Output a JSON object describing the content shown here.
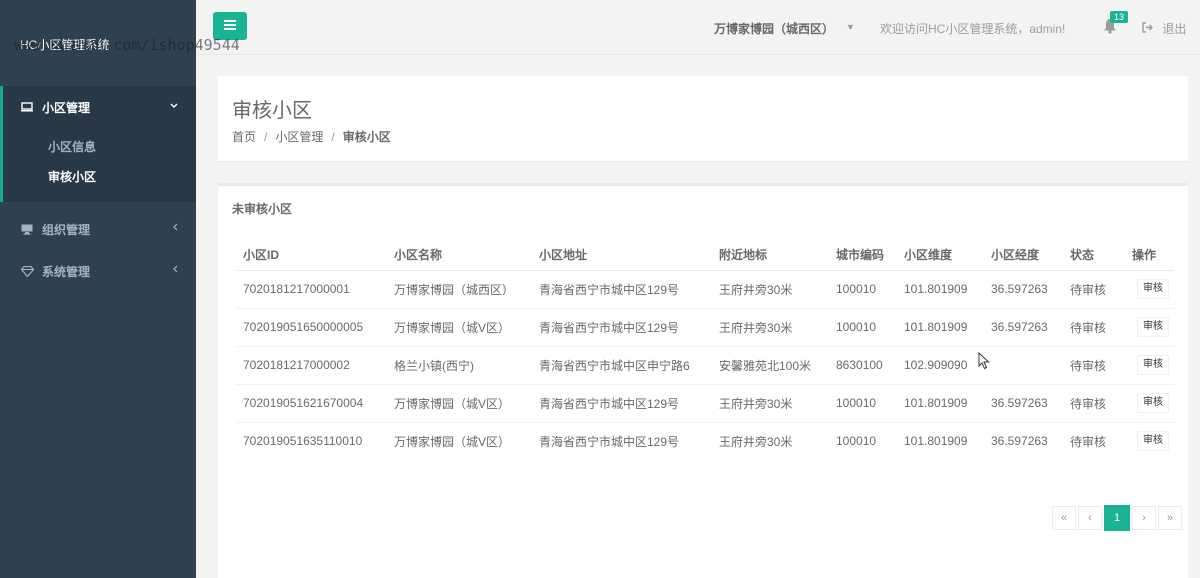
{
  "app": {
    "title": "HC小区管理系统",
    "watermark": "www.huzhan.com/ishop49544"
  },
  "sidebar": {
    "items": [
      {
        "label": "小区管理",
        "icon": "monitor-icon",
        "expanded": true,
        "children": [
          {
            "label": "小区信息"
          },
          {
            "label": "审核小区"
          }
        ]
      },
      {
        "label": "组织管理",
        "icon": "desktop-icon"
      },
      {
        "label": "系统管理",
        "icon": "diamond-icon"
      }
    ]
  },
  "topbar": {
    "community": "万博家博园（城西区）",
    "welcome": "欢迎访问HC小区管理系统，admin!",
    "notification_count": "13",
    "logout": "退出"
  },
  "page": {
    "title": "审核小区",
    "breadcrumb": [
      "首页",
      "小区管理",
      "审核小区"
    ]
  },
  "panel": {
    "title": "未审核小区",
    "columns": [
      "小区ID",
      "小区名称",
      "小区地址",
      "附近地标",
      "城市编码",
      "小区维度",
      "小区经度",
      "状态",
      "操作"
    ],
    "rows": [
      {
        "id": "7020181217000001",
        "name": "万博家博园（城西区）",
        "address": "青海省西宁市城中区129号",
        "landmark": "王府井旁30米",
        "city_code": "100010",
        "lat": "101.801909",
        "lng": "36.597263",
        "state": "待审核",
        "action": "审核"
      },
      {
        "id": "702019051650000005",
        "name": "万博家博园（城V区）",
        "address": "青海省西宁市城中区129号",
        "landmark": "王府井旁30米",
        "city_code": "100010",
        "lat": "101.801909",
        "lng": "36.597263",
        "state": "待审核",
        "action": "审核"
      },
      {
        "id": "7020181217000002",
        "name": "格兰小镇(西宁)",
        "address": "青海省西宁市城中区申宁路6",
        "landmark": "安馨雅苑北100米",
        "city_code": "8630100",
        "lat": "102.909090",
        "lng": "",
        "state": "待审核",
        "action": "审核"
      },
      {
        "id": "702019051621670004",
        "name": "万博家博园（城V区）",
        "address": "青海省西宁市城中区129号",
        "landmark": "王府井旁30米",
        "city_code": "100010",
        "lat": "101.801909",
        "lng": "36.597263",
        "state": "待审核",
        "action": "审核"
      },
      {
        "id": "702019051635110010",
        "name": "万博家博园（城V区）",
        "address": "青海省西宁市城中区129号",
        "landmark": "王府井旁30米",
        "city_code": "100010",
        "lat": "101.801909",
        "lng": "36.597263",
        "state": "待审核",
        "action": "审核"
      }
    ]
  },
  "pagination": {
    "first": "«",
    "prev": "‹",
    "current": "1",
    "next": "›",
    "last": "»"
  },
  "colors": {
    "accent": "#1ab394",
    "sidebar_bg": "#2f4050"
  }
}
